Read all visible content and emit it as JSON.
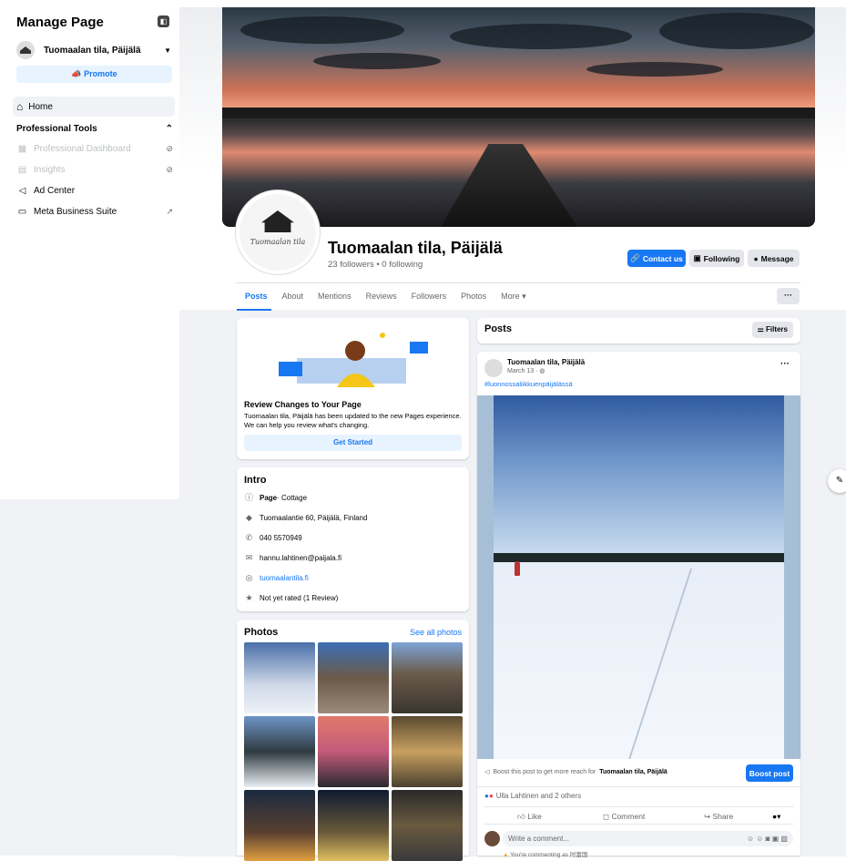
{
  "sidebar": {
    "title": "Manage Page",
    "page_name": "Tuomaalan tila, Päijälä",
    "promote": "Promote",
    "home": "Home",
    "section": "Professional Tools",
    "items": [
      {
        "label": "Professional Dashboard",
        "icon": "dashboard-icon",
        "disabled": true
      },
      {
        "label": "Insights",
        "icon": "insights-icon",
        "disabled": true
      },
      {
        "label": "Ad Center",
        "icon": "megaphone-icon",
        "disabled": false
      },
      {
        "label": "Meta Business Suite",
        "icon": "briefcase-icon",
        "disabled": false
      }
    ]
  },
  "profile": {
    "logo_text": "Tuomaalan tila",
    "name": "Tuomaalan tila, Päijälä",
    "stats": "23 followers • 0 following",
    "buttons": {
      "contact": "Contact us",
      "following": "Following",
      "message": "Message"
    }
  },
  "tabs": [
    "Posts",
    "About",
    "Mentions",
    "Reviews",
    "Followers",
    "Photos",
    "More ▾"
  ],
  "tab_more": "···",
  "review": {
    "title": "Review Changes to Your Page",
    "text": "Tuomaalan tila, Päijälä has been updated to the new Pages experience. We can help you review what's changing.",
    "button": "Get Started"
  },
  "intro": {
    "title": "Intro",
    "page_label": "Page",
    "page_cat": " · Cottage",
    "address": "Tuomaalantie 60, Päijälä, Finland",
    "phone": "040 5570949",
    "email": "hannu.lahtinen@paijala.fi",
    "website": "tuomaalantila.fi",
    "rating": "Not yet rated (1 Review)"
  },
  "photos": {
    "title": "Photos",
    "see_all": "See all photos"
  },
  "posts": {
    "title": "Posts",
    "filters": "Filters",
    "author": "Tuomaalan tila, Päijälä",
    "date": "March 13 · ",
    "hashtag": "#luonnossaliikkuenpäijälässä",
    "boost_text_pre": "Boost this post to get more reach for ",
    "boost_text_bold": "Tuomaalan tila, Päijälä",
    "boost_button": "Boost post",
    "reactions": "Ulla Lahtinen and 2 others",
    "like": "Like",
    "comment": "Comment",
    "share": "Share",
    "comment_placeholder": "Write a comment...",
    "commenting_as": "You're commenting as 时富国"
  },
  "colors": {
    "accent": "#1877f2",
    "bg": "#f0f2f5"
  }
}
